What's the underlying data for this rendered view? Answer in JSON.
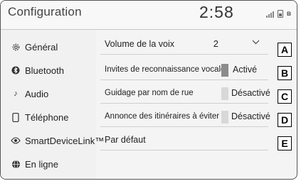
{
  "header": {
    "title": "Configuration",
    "clock": "2:58"
  },
  "sidebar": {
    "items": [
      {
        "label": "Général",
        "icon": "gear-icon"
      },
      {
        "label": "Bluetooth",
        "icon": "bluetooth-icon"
      },
      {
        "label": "Audio",
        "icon": "music-note-icon"
      },
      {
        "label": "Téléphone",
        "icon": "phone-icon"
      },
      {
        "label": "SmartDeviceLink™",
        "icon": "smartdevicelink-icon"
      },
      {
        "label": "En ligne",
        "icon": "globe-icon"
      }
    ]
  },
  "settings": {
    "voice_volume": {
      "label": "Volume de la voix",
      "value": "2"
    },
    "voice_prompts": {
      "label": "Invites de reconnaissance vocale",
      "state": "Activé",
      "on": true
    },
    "street_guidance": {
      "label": "Guidage par nom de rue",
      "state": "Désactivé",
      "on": false
    },
    "avoid_routes": {
      "label": "Annonce des itinéraires à éviter",
      "state": "Désactivé",
      "on": false
    },
    "default": {
      "label": "Par défaut"
    }
  },
  "markers": [
    "A",
    "B",
    "C",
    "D",
    "E"
  ]
}
